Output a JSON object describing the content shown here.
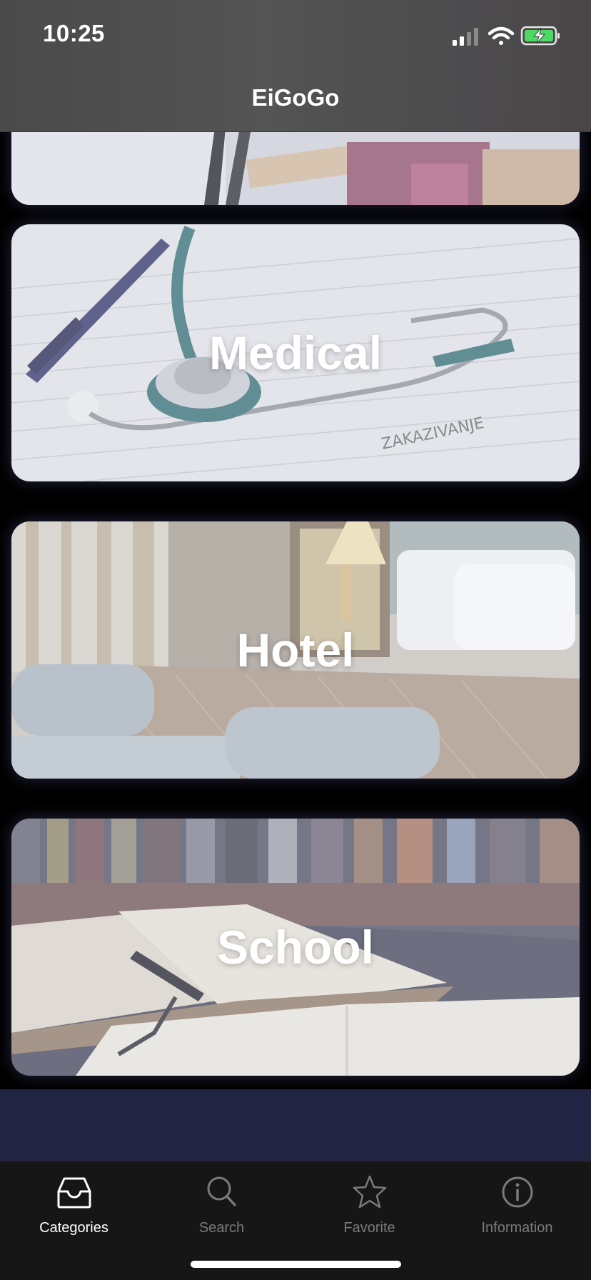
{
  "status_bar": {
    "time": "10:25",
    "icons": [
      "signal-icon",
      "wifi-icon",
      "battery-charging-icon"
    ],
    "battery_color": "#4cd964"
  },
  "nav": {
    "title": "EiGoGo"
  },
  "categories": [
    {
      "label": ""
    },
    {
      "label": "Medical"
    },
    {
      "label": "Hotel"
    },
    {
      "label": "School"
    }
  ],
  "tab_bar": {
    "tabs": [
      {
        "label": "Categories",
        "icon": "inbox-tray-icon",
        "active": true
      },
      {
        "label": "Search",
        "icon": "search-icon",
        "active": false
      },
      {
        "label": "Favorite",
        "icon": "star-icon",
        "active": false
      },
      {
        "label": "Information",
        "icon": "info-icon",
        "active": false
      }
    ],
    "active_color": "#ffffff",
    "inactive_color": "#7a7a7a"
  },
  "colors": {
    "strip": "#222443",
    "tab_bar_bg": "#161616"
  }
}
